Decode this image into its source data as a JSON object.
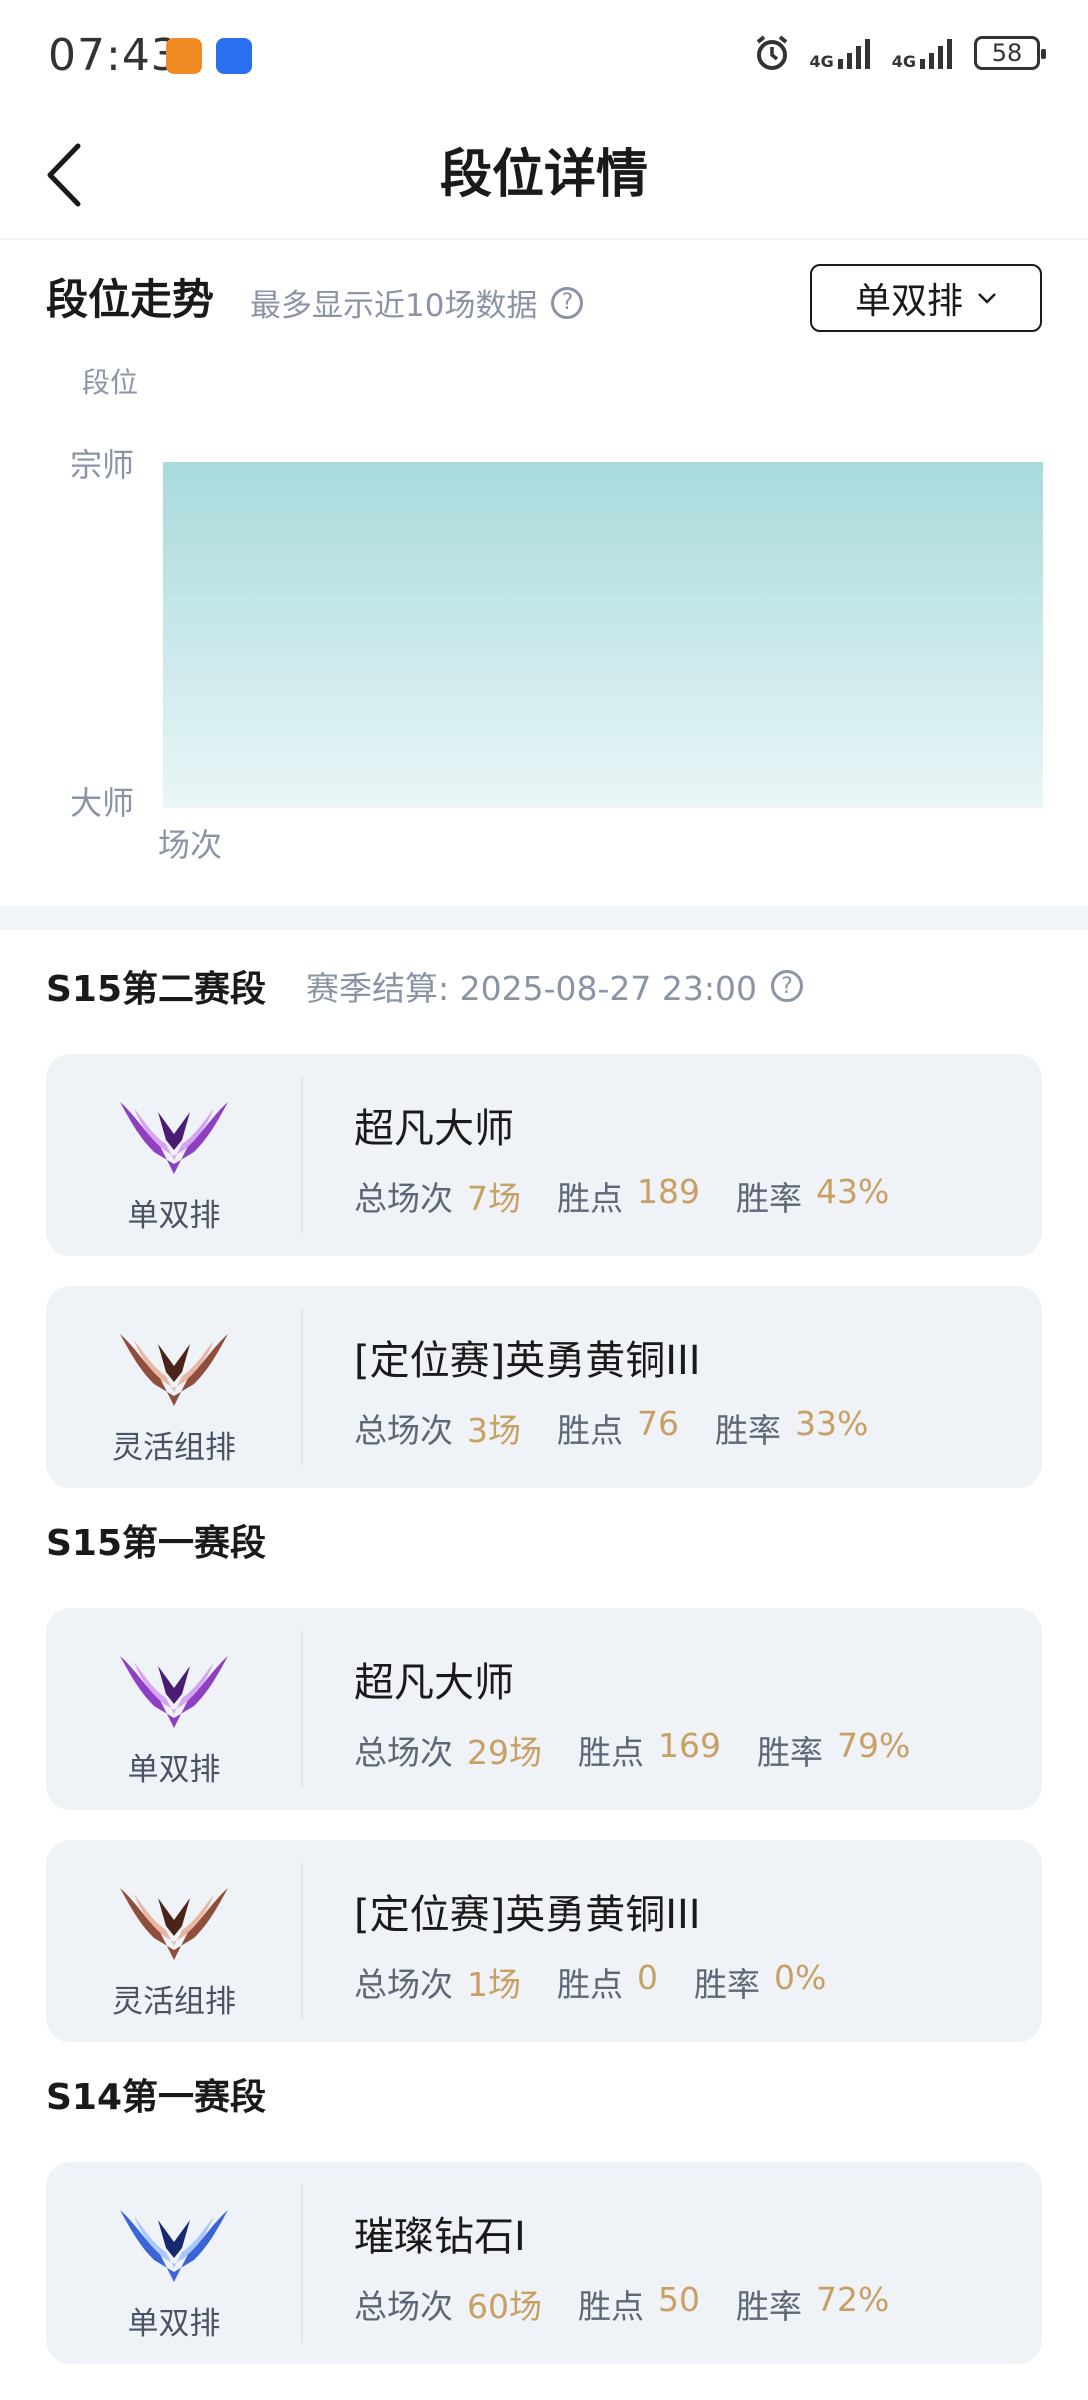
{
  "status_bar": {
    "time": "07:43",
    "net1": "4G",
    "net2": "4G",
    "battery": "58"
  },
  "header": {
    "title": "段位详情"
  },
  "trend": {
    "title": "段位走势",
    "hint": "最多显示近10场数据",
    "queue_selector": "单双排",
    "chart_data": {
      "type": "area",
      "ylabel": "段位",
      "xlabel": "场次",
      "y_ticks": [
        "宗师",
        "大师"
      ],
      "x": [],
      "values": [],
      "fill_colors": [
        "#a8dadc",
        "#eaf6f7"
      ]
    }
  },
  "seasons": [
    {
      "title": "S15第二赛段",
      "note": "赛季结算: 2025-08-27 23:00",
      "cards": [
        {
          "queue": "单双排",
          "tier": "master",
          "rank": "超凡大师",
          "games_label": "总场次",
          "games": "7场",
          "lp_label": "胜点",
          "lp": "189",
          "wr_label": "胜率",
          "winrate": "43%"
        },
        {
          "queue": "灵活组排",
          "tier": "bronze",
          "rank": "[定位赛]英勇黄铜III",
          "games_label": "总场次",
          "games": "3场",
          "lp_label": "胜点",
          "lp": "76",
          "wr_label": "胜率",
          "winrate": "33%"
        }
      ]
    },
    {
      "title": "S15第一赛段",
      "cards": [
        {
          "queue": "单双排",
          "tier": "master",
          "rank": "超凡大师",
          "games_label": "总场次",
          "games": "29场",
          "lp_label": "胜点",
          "lp": "169",
          "wr_label": "胜率",
          "winrate": "79%"
        },
        {
          "queue": "灵活组排",
          "tier": "bronze",
          "rank": "[定位赛]英勇黄铜III",
          "games_label": "总场次",
          "games": "1场",
          "lp_label": "胜点",
          "lp": "0",
          "wr_label": "胜率",
          "winrate": "0%"
        }
      ]
    },
    {
      "title": "S14第一赛段",
      "cards": [
        {
          "queue": "单双排",
          "tier": "diamond",
          "rank": "璀璨钻石I",
          "games_label": "总场次",
          "games": "60场",
          "lp_label": "胜点",
          "lp": "50",
          "wr_label": "胜率",
          "winrate": "72%"
        }
      ]
    }
  ]
}
